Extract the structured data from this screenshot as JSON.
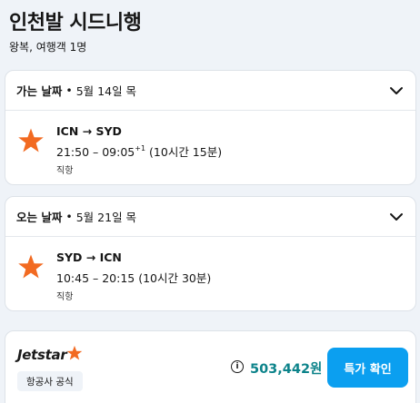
{
  "page": {
    "title": "인천발 시드니행",
    "subtitle": "왕복, 여행객 1명"
  },
  "outbound": {
    "direction_label": "가는 날짜",
    "separator": "•",
    "date": "5월 14일 목",
    "route": "ICN → SYD",
    "times": "21:50 – 09:05",
    "day_offset": "+1",
    "duration": "(10시간 15분)",
    "stops": "직항",
    "airline_icon": "jetstar-star-icon"
  },
  "return": {
    "direction_label": "오는 날짜",
    "separator": "•",
    "date": "5월 21일 목",
    "route": "SYD → ICN",
    "times": "10:45 – 20:15 (10시간 30분)",
    "stops": "직항",
    "airline_icon": "jetstar-star-icon"
  },
  "offer": {
    "airline_logo_text": "Jetstar",
    "badge": "항공사 공식",
    "info_icon": "info-icon",
    "price": "503,442원",
    "button_label": "특가 확인"
  },
  "colors": {
    "background": "#eff3f8",
    "star": "#f26a21",
    "price": "#0c838a",
    "button": "#0b9ff0"
  }
}
